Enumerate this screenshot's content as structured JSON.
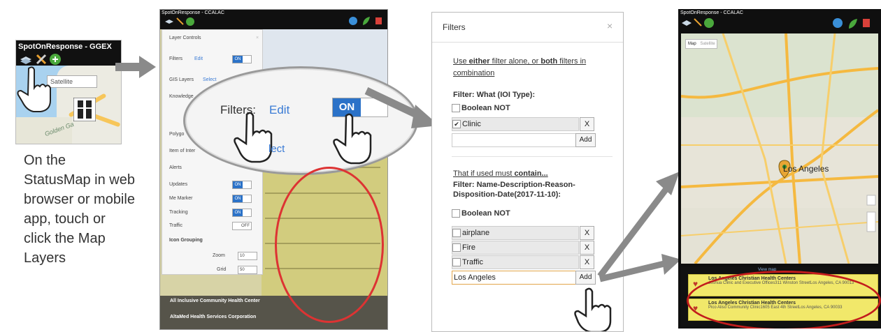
{
  "panel1": {
    "app_title": "SpotOnResponse - GGEX",
    "map_type_label": "Satellite",
    "map_label": "Golden Ga"
  },
  "caption": {
    "text": "On the StatusMap in web browser or mobile app, touch or click the Map Layers"
  },
  "panel2": {
    "app_title": "SpotOnResponse - CCALAC",
    "dialog_title": "Layer Controls",
    "filters_label": "Filters",
    "filters_edit": "Edit",
    "on_label": "ON",
    "off_label": "OFF",
    "gis_layers_label": "GIS Layers",
    "gis_select": "Select",
    "knowledge_label": "Knowledge",
    "polygon_label": "Polygo",
    "item_of_interest_label": "Item of Inter",
    "alerts_label": "Alerts",
    "updates_label": "Updates",
    "me_marker_label": "Me Marker",
    "tracking_label": "Tracking",
    "traffic_label": "Traffic",
    "icon_grouping_label": "Icon Grouping",
    "zoom_label": "Zoom",
    "zoom_value": "10",
    "grid_label": "Grid",
    "grid_value": "50",
    "zoom_filters_label": "Filters:",
    "zoom_edit_label": "Edit",
    "zoom_on_label": "ON",
    "select_fragment": "lect",
    "list_item_1": "All Inclusive Community Health Center",
    "list_item_2": "AltaMed Health Services Corporation"
  },
  "panel3": {
    "title": "Filters",
    "intro_1": "Use ",
    "intro_either": "either",
    "intro_2": " filter alone, or ",
    "intro_both": "both",
    "intro_3": " filters in combination",
    "filter_what_label": "Filter: What (IOI Type):",
    "boolean_not_label": "Boolean NOT",
    "clinic_value": "Clinic",
    "x_label": "X",
    "add_label": "Add",
    "contain_1": "That if used must ",
    "contain_bold": "contain...",
    "filter_name_label": "Filter: Name-Description-Reason-Disposition-Date(2017-11-10):",
    "boolean_not_label_2": "Boolean NOT",
    "term_1": "airplane",
    "term_2": "Fire",
    "term_3": "Traffic",
    "input_value": "Los Angeles"
  },
  "panel4": {
    "app_title": "SpotOnResponse - CCALAC",
    "map_label": "Map",
    "satellite_label": "Satellite",
    "city_label": "Los Angeles",
    "view_map_label": "View map",
    "result_1_name": "Los Angeles Christian Health Centers",
    "result_1_detail": "Joshua Clinic and Executive Offices311 Winston StreetLos Angeles, CA 90013",
    "result_2_name": "Los Angeles Christian Health Centers",
    "result_2_detail": "Pico Aliso Community Clinic1605 East 4th StreetLos Angeles, CA 90033"
  },
  "colors": {
    "accent_blue": "#2b72c8",
    "annotation_red": "#d33",
    "arrow_gray": "#8a8a8a",
    "highlight_yellow": "#f1e86a"
  }
}
